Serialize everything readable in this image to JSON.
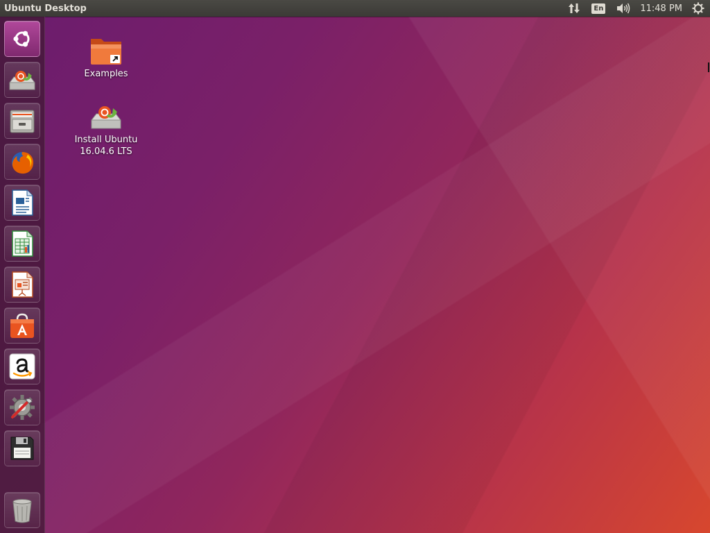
{
  "panel": {
    "title": "Ubuntu Desktop",
    "keyboard_layout": "En",
    "clock": "11:48 PM",
    "indicators": [
      "network-icon",
      "keyboard-layout-indicator",
      "volume-icon",
      "clock",
      "power-gear-icon"
    ]
  },
  "launcher": {
    "items": [
      {
        "name": "dash-home",
        "icon": "ubuntu-logo-icon"
      },
      {
        "name": "install-ubuntu",
        "icon": "installer-icon"
      },
      {
        "name": "files",
        "icon": "file-cabinet-icon"
      },
      {
        "name": "firefox",
        "icon": "firefox-icon"
      },
      {
        "name": "libreoffice-writer",
        "icon": "writer-icon"
      },
      {
        "name": "libreoffice-calc",
        "icon": "calc-icon"
      },
      {
        "name": "libreoffice-impress",
        "icon": "impress-icon"
      },
      {
        "name": "ubuntu-software",
        "icon": "software-center-icon"
      },
      {
        "name": "amazon",
        "icon": "amazon-icon"
      },
      {
        "name": "system-settings",
        "icon": "settings-icon"
      },
      {
        "name": "removable-drive",
        "icon": "floppy-drive-icon"
      },
      {
        "name": "trash",
        "icon": "trash-icon"
      }
    ]
  },
  "desktop": {
    "icons": [
      {
        "label": "Examples",
        "icon": "folder-link-icon"
      },
      {
        "label": "Install Ubuntu\n16.04.6 LTS",
        "icon": "installer-icon"
      }
    ]
  },
  "colors": {
    "panel": "#3c3b37",
    "wallpaper_start": "#6a1c6e",
    "wallpaper_end": "#d7472e",
    "launcher": "#421836"
  }
}
